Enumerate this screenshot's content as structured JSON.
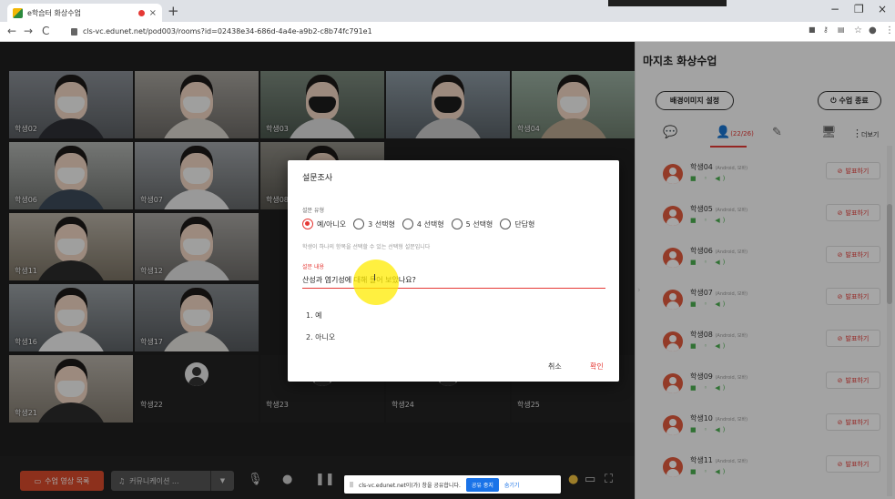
{
  "browser": {
    "tab_title": "e학습터 화상수업",
    "tab_close": "×",
    "new_tab": "+",
    "url": "cls-vc.edunet.net/pod003/rooms?id=02438e34-686d-4a4e-a9b2-c8b74fc791e1",
    "back": "←",
    "forward": "→",
    "reload": "C",
    "minimize": "−",
    "maximize": "❐",
    "close": "×",
    "star": "☆",
    "profile": "●",
    "menu": "⋮"
  },
  "video": {
    "tiles": [
      {
        "name": "학생02"
      },
      {
        "name": ""
      },
      {
        "name": "학생03"
      },
      {
        "name": ""
      },
      {
        "name": "학생04"
      },
      {
        "name": "학생06"
      },
      {
        "name": "학생07"
      },
      {
        "name": "학생08"
      },
      {
        "name": "학생11"
      },
      {
        "name": "학생12"
      },
      {
        "name": "학생16"
      },
      {
        "name": "학생17"
      },
      {
        "name": "학생21"
      }
    ],
    "empty_tiles": [
      {
        "name": "학생22"
      },
      {
        "name": "학생23"
      },
      {
        "name": "학생24"
      },
      {
        "name": "학생25"
      }
    ]
  },
  "panel": {
    "title": "마지초 화상수업",
    "bg_button": "배경이미지 설정",
    "end_button": "수업 종료",
    "participants_count": "(22/26)",
    "more_label": "더보기",
    "students": [
      {
        "name": "학생04",
        "sub": "(Android, 모바)",
        "action": "발표하기"
      },
      {
        "name": "학생05",
        "sub": "(Android, 모바)",
        "action": "발표하기"
      },
      {
        "name": "학생06",
        "sub": "(Android, 모바)",
        "action": "발표하기"
      },
      {
        "name": "학생07",
        "sub": "(Android, 모바)",
        "action": "발표하기"
      },
      {
        "name": "학생08",
        "sub": "(Android, 모바)",
        "action": "발표하기"
      },
      {
        "name": "학생09",
        "sub": "(Android, 모바)",
        "action": "발표하기"
      },
      {
        "name": "학생10",
        "sub": "(Android, 모바)",
        "action": "발표하기"
      },
      {
        "name": "학생11",
        "sub": "(Android, 모바)",
        "action": "발표하기"
      }
    ]
  },
  "toolbar": {
    "class_video_list": "수업 영상 목록",
    "communication": "커뮤니케이션 ..."
  },
  "share": {
    "text": "cls-vc.edunet.net이(가) 창을 공유합니다.",
    "stop": "공유 중지",
    "hide": "숨기기"
  },
  "modal": {
    "title": "설문조사",
    "type_label": "설문 유형",
    "options": [
      "예/아니오",
      "3 선택형",
      "4 선택형",
      "5 선택형",
      "단답형"
    ],
    "selected_index": 0,
    "hint": "학생이 하나의 항목을 선택할 수 있는 선택형 설문입니다",
    "content_label": "설문 내용",
    "question": "산성과 염기성에 대해 들어 보았나요?",
    "answers": [
      "1.  예",
      "2.  아니오"
    ],
    "cancel": "취소",
    "ok": "확인"
  },
  "colors": {
    "accent": "#e53935",
    "record_button": "#d94b2b",
    "avatar": "#e25b3e",
    "share_stop": "#1a73e8"
  }
}
